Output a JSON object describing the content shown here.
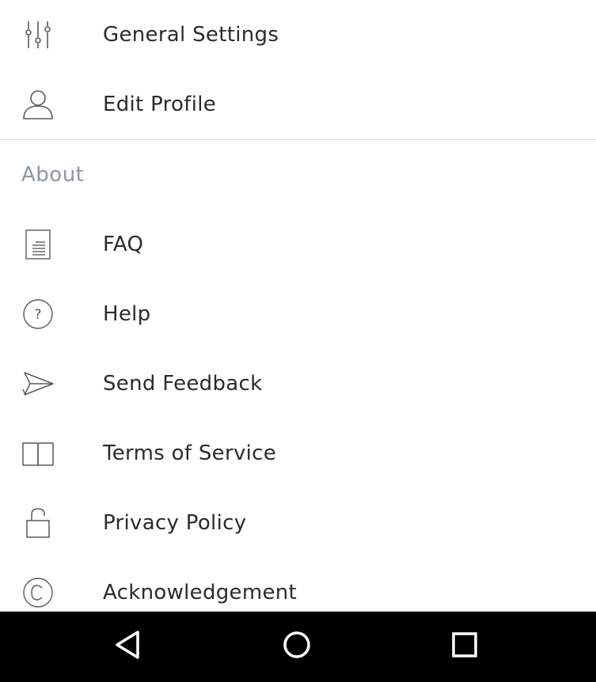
{
  "menu": {
    "general_settings": "General Settings",
    "edit_profile": "Edit Profile"
  },
  "about": {
    "header": "About",
    "faq": "FAQ",
    "help": "Help",
    "send_feedback": "Send Feedback",
    "terms_of_service": "Terms of Service",
    "privacy_policy": "Privacy Policy",
    "acknowledgement": "Acknowledgement"
  },
  "icons": {
    "general_settings": "sliders-icon",
    "edit_profile": "person-icon",
    "faq": "document-icon",
    "help": "question-circle-icon",
    "send_feedback": "paper-plane-icon",
    "terms_of_service": "open-book-icon",
    "privacy_policy": "lock-icon",
    "acknowledgement": "copyright-icon"
  },
  "navbar": {
    "buttons": [
      "back",
      "home",
      "recents"
    ]
  },
  "colors": {
    "text": "#2b2b2b",
    "section_header": "#8d97a3",
    "icon_stroke": "#5a5a5a",
    "divider": "#e0e0e0",
    "navbar_bg": "#000000",
    "navbar_icon": "#ffffff"
  }
}
